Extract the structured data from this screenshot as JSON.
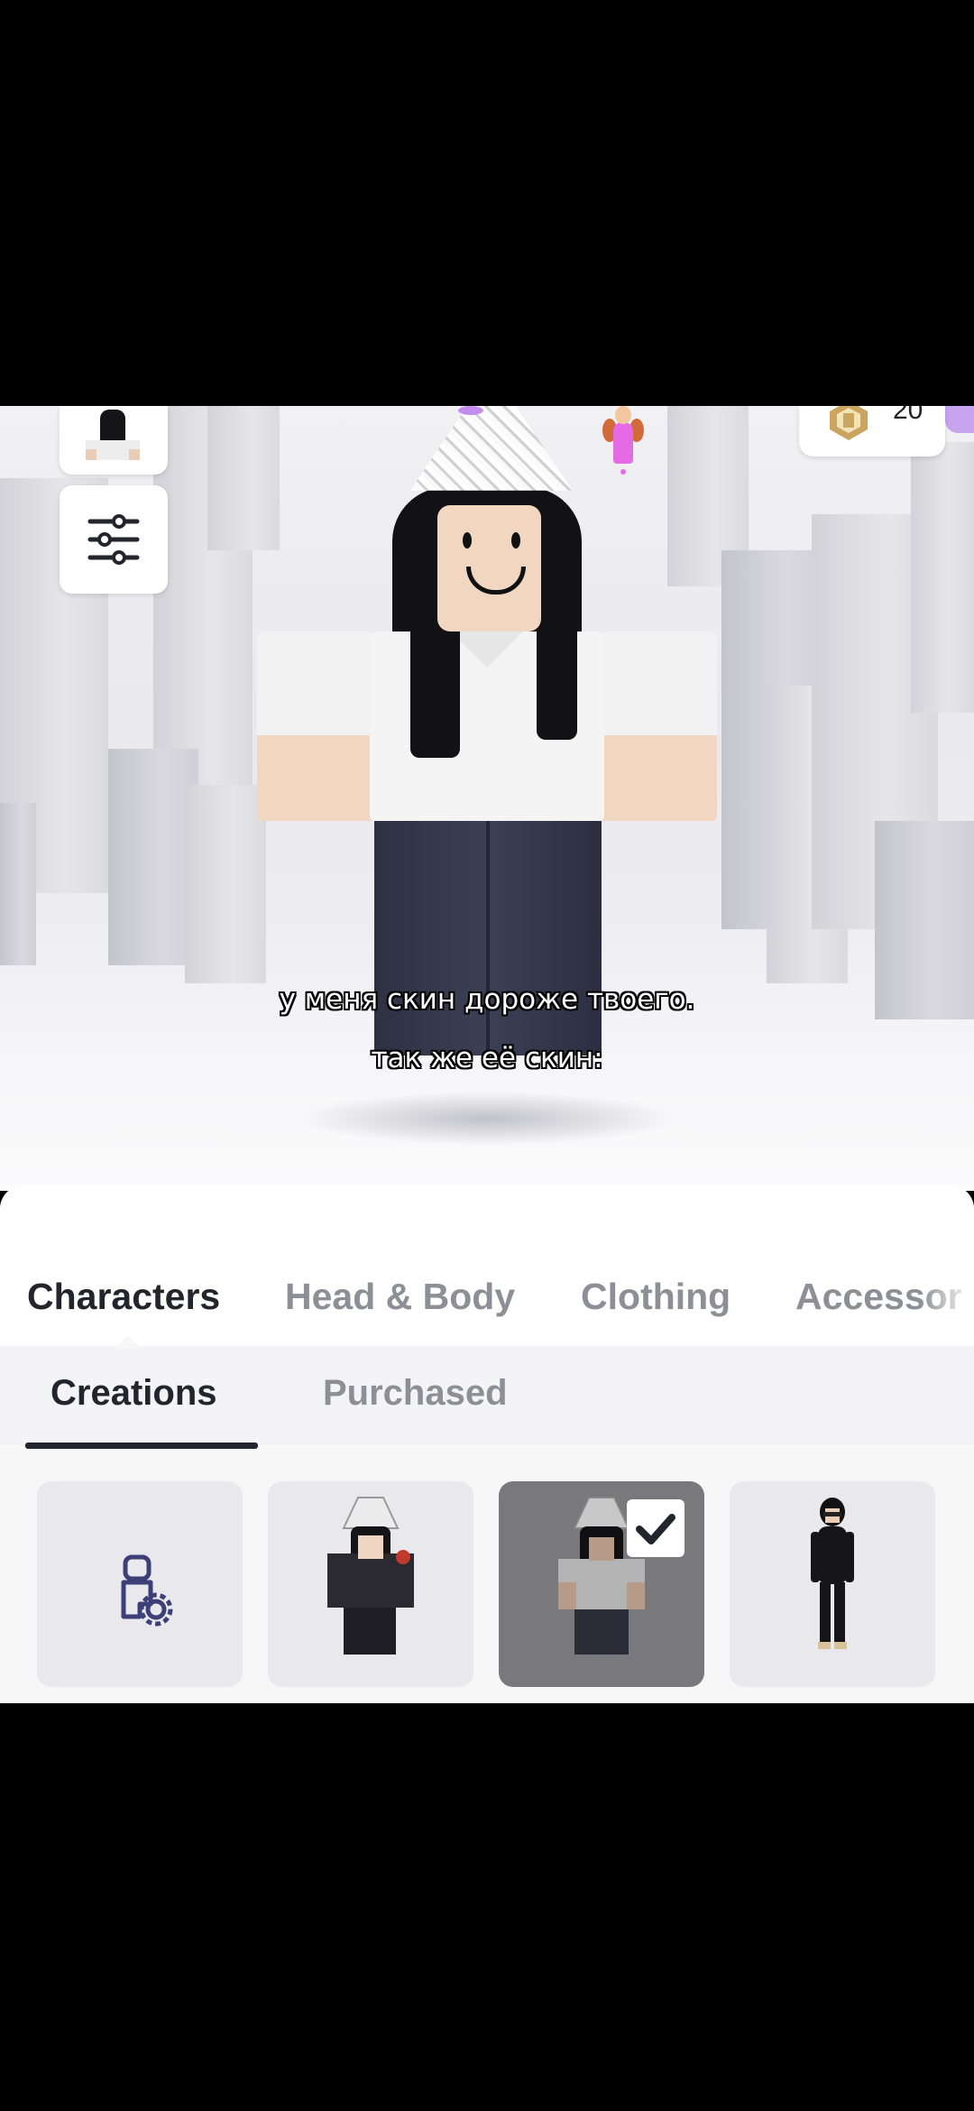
{
  "scene": {
    "currency_amount": "20",
    "caption_line1": "у меня скин дороже твоего.",
    "caption_line2": "так же её скин:"
  },
  "icons": {
    "avatar_thumbnail": "avatar-thumbnail-icon",
    "filter": "sliders-icon",
    "currency": "robux-icon",
    "create": "person-gear-icon",
    "selected": "checkmark-icon"
  },
  "main_tabs": [
    {
      "label": "Characters",
      "active": true
    },
    {
      "label": "Head & Body",
      "active": false
    },
    {
      "label": "Clothing",
      "active": false
    },
    {
      "label": "Accessor",
      "active": false
    }
  ],
  "sub_tabs": [
    {
      "label": "Creations",
      "active": true
    },
    {
      "label": "Purchased",
      "active": false
    }
  ],
  "items": [
    {
      "kind": "create-new",
      "selected": false
    },
    {
      "kind": "character",
      "selected": false
    },
    {
      "kind": "character",
      "selected": true
    },
    {
      "kind": "character",
      "selected": false
    }
  ],
  "colors": {
    "active_text": "#23252c",
    "inactive_text": "#8d8f96",
    "selected_tile": "#78787d",
    "tile_bg": "#e9e9ed",
    "create_icon": "#3d3f78"
  }
}
